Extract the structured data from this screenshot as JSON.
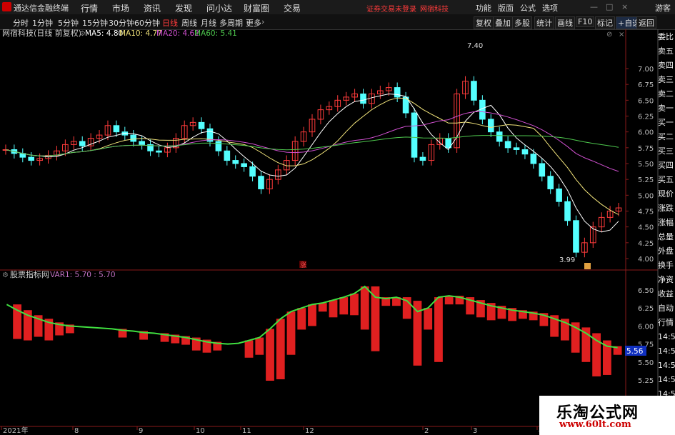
{
  "app": {
    "title": "通达信金融终端"
  },
  "menu": [
    "行情",
    "市场",
    "资讯",
    "发现",
    "问小达",
    "财富圈",
    "交易"
  ],
  "warning": {
    "text1": "证券交易未登录",
    "text2": "网宿科技"
  },
  "right_menu": [
    "功能",
    "版面",
    "公式",
    "选项",
    "游客"
  ],
  "toolbar": {
    "periods": [
      "分时",
      "1分钟",
      "5分钟",
      "15分钟",
      "30分钟",
      "60分钟",
      "日线",
      "周线",
      "月线",
      "多周期",
      "更多"
    ],
    "active_period": "日线",
    "buttons": [
      "复权",
      "叠加",
      "多股",
      "统计",
      "画线",
      "F10",
      "标记",
      "+自选",
      "返回"
    ]
  },
  "main_chart": {
    "name": "网宿科技(日线 前复权)",
    "ma": [
      {
        "label": "MA5: 4.80",
        "color": "#ffffff"
      },
      {
        "label": "MA10: 4.77",
        "color": "#f0e27a"
      },
      {
        "label": "MA20: 4.62",
        "color": "#d050d0"
      },
      {
        "label": "MA60: 5.41",
        "color": "#4ec84e"
      }
    ],
    "y_ticks": [
      "7.00",
      "6.75",
      "6.50",
      "6.25",
      "6.00",
      "5.75",
      "5.50",
      "5.25",
      "5.00",
      "4.75",
      "4.50",
      "4.25",
      "4.00"
    ],
    "high_label": "7.40",
    "low_label": "3.99",
    "marker": "涨"
  },
  "indicator": {
    "name": "股票指标网",
    "var_label": "VAR1: 5.70 : 5.70",
    "y_ticks": [
      "6.50",
      "6.25",
      "6.00",
      "5.75",
      "5.50",
      "5.25"
    ],
    "current_value": "5.56"
  },
  "x_axis": [
    "2021年",
    "8",
    "9",
    "10",
    "11",
    "12",
    "2",
    "3",
    "4"
  ],
  "side_panel": [
    "委比",
    "卖五",
    "卖四",
    "卖三",
    "卖二",
    "卖一",
    "买一",
    "买二",
    "买三",
    "买四",
    "买五",
    "现价",
    "涨跌",
    "涨幅",
    "总量",
    "外盘",
    "换手",
    "净资",
    "收益",
    "自动",
    "行情",
    "14:5",
    "14:5",
    "14:5",
    "14:5",
    "14:5",
    "14:5",
    "14:5",
    "14:5"
  ],
  "watermark": {
    "title": "乐淘公式网",
    "url": "www.60lt.com"
  },
  "chart_data": {
    "type": "line",
    "title": "网宿科技(日线 前复权)",
    "x_ticks": [
      "2021年",
      "8",
      "9",
      "10",
      "11",
      "12",
      "2",
      "3",
      "4"
    ],
    "ylim": [
      3.9,
      7.3
    ],
    "high": 7.4,
    "low": 3.99,
    "close": [
      5.72,
      5.66,
      5.6,
      5.55,
      5.58,
      5.63,
      5.7,
      5.8,
      5.85,
      5.78,
      5.9,
      5.95,
      6.1,
      6.0,
      5.95,
      5.85,
      5.8,
      5.7,
      5.68,
      5.75,
      5.9,
      6.1,
      6.15,
      6.05,
      5.85,
      5.7,
      5.55,
      5.5,
      5.45,
      5.3,
      5.1,
      5.25,
      5.4,
      5.55,
      5.85,
      6.0,
      6.2,
      6.35,
      6.4,
      6.5,
      6.55,
      6.6,
      6.45,
      6.6,
      6.65,
      6.7,
      6.55,
      6.3,
      5.6,
      5.55,
      5.8,
      5.9,
      5.75,
      6.6,
      6.8,
      6.5,
      6.2,
      6.0,
      5.85,
      5.75,
      5.72,
      5.65,
      5.5,
      5.3,
      5.1,
      4.9,
      4.6,
      4.1,
      4.25,
      4.5,
      4.65,
      4.75,
      4.8
    ],
    "series": [
      {
        "name": "MA5",
        "values": [
          4.8
        ]
      },
      {
        "name": "MA10",
        "values": [
          4.77
        ]
      },
      {
        "name": "MA20",
        "values": [
          4.62
        ]
      },
      {
        "name": "MA60",
        "values": [
          5.41
        ]
      }
    ],
    "indicator": {
      "name": "VAR1",
      "ylim": [
        5.25,
        6.6
      ],
      "line": [
        6.3,
        6.22,
        6.15,
        6.1,
        6.05,
        6.02,
        6.0,
        5.99,
        5.98,
        5.97,
        5.96,
        5.94,
        5.93,
        5.91,
        5.9,
        5.88,
        5.86,
        5.84,
        5.81,
        5.78,
        5.76,
        5.75,
        5.76,
        5.8,
        5.84,
        5.96,
        6.1,
        6.2,
        6.25,
        6.3,
        6.32,
        6.36,
        6.4,
        6.45,
        6.55,
        6.4,
        6.38,
        6.4,
        6.35,
        6.2,
        6.25,
        6.4,
        6.42,
        6.4,
        6.36,
        6.32,
        6.28,
        6.25,
        6.22,
        6.2,
        6.18,
        6.15,
        6.1,
        6.05,
        5.98,
        5.9,
        5.8,
        5.72,
        5.7
      ],
      "current": 5.56
    }
  }
}
